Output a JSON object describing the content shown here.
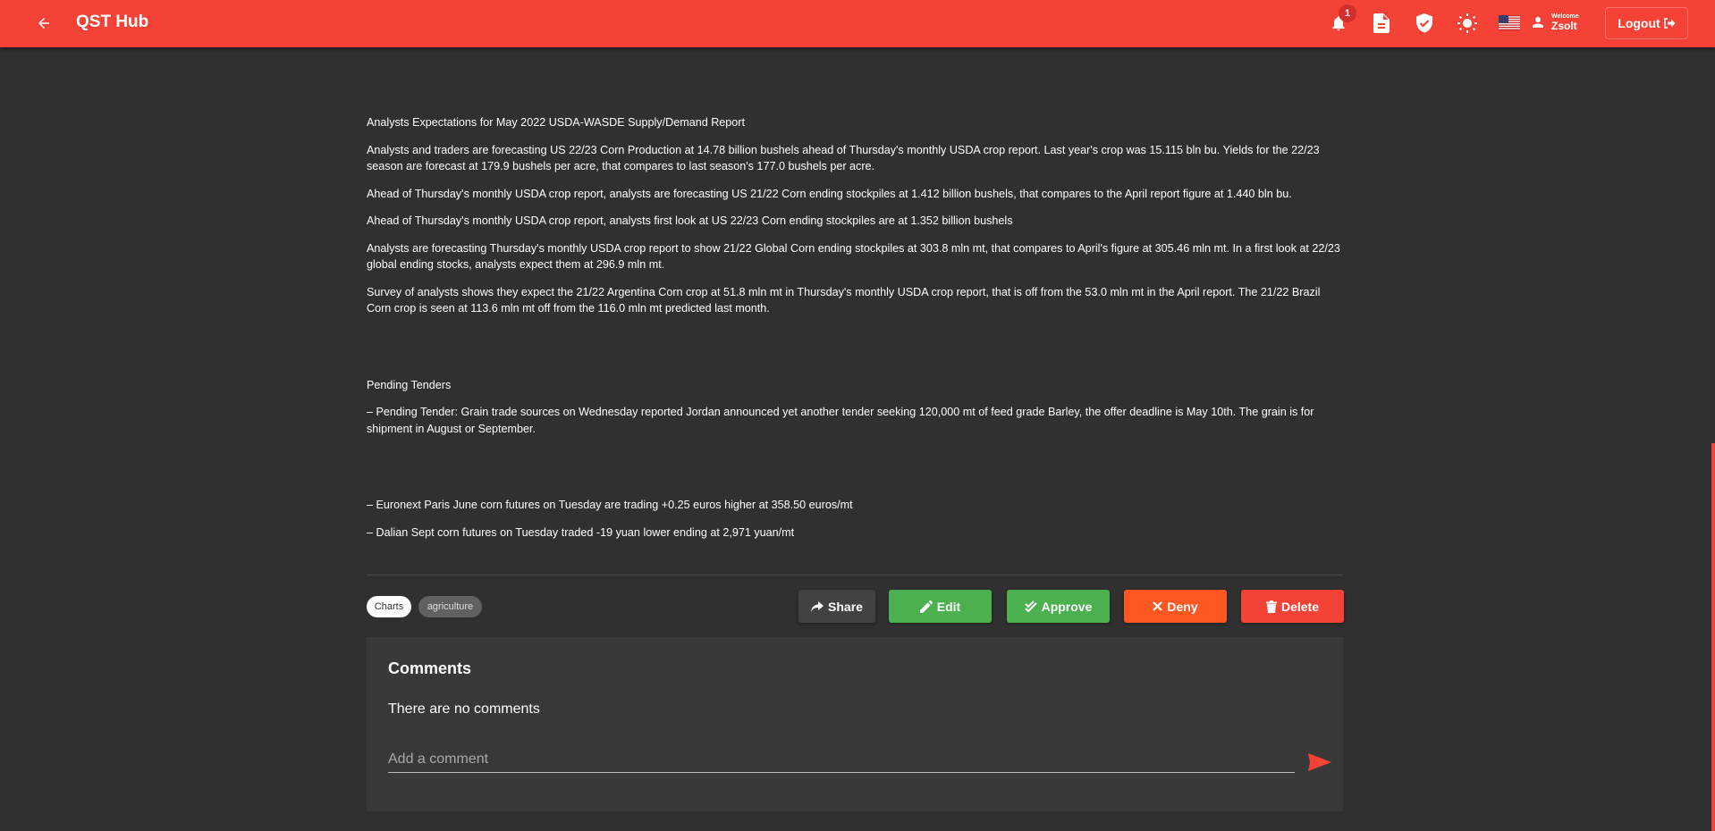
{
  "header": {
    "title": "QST Hub",
    "notification_count": "1",
    "welcome_label": "Welcome",
    "username": "Zsolt",
    "logout_label": "Logout",
    "icons": [
      "arrow-back-icon",
      "bell-icon",
      "document-icon",
      "shield-check-icon",
      "sun-icon",
      "us-flag-icon",
      "user-icon",
      "logout-icon"
    ]
  },
  "article": {
    "section1_title": "Analysts Expectations for May 2022 USDA-WASDE Supply/Demand Report",
    "paragraphs1": [
      "Analysts and traders are forecasting US 22/23 Corn Production at 14.78 billion bushels ahead of Thursday's monthly USDA crop report. Last year's crop was 15.115 bln bu. Yields for the 22/23 season are forecast at 179.9 bushels per acre, that compares to last season's 177.0 bushels per acre.",
      "Ahead of Thursday's monthly USDA crop report, analysts are forecasting US 21/22 Corn ending stockpiles at 1.412 billion bushels, that compares to the April report figure at 1.440 bln bu.",
      "Ahead of Thursday's monthly USDA crop report, analysts first look at US 22/23 Corn ending stockpiles are at 1.352 billion bushels",
      "Analysts are forecasting Thursday's monthly USDA crop report to show 21/22 Global Corn ending stockpiles at 303.8 mln mt, that compares to April's figure at 305.46 mln mt. In a first look at 22/23 global ending stocks, analysts expect them at 296.9 mln mt.",
      "Survey of analysts shows they expect the 21/22 Argentina Corn crop at 51.8 mln mt in Thursday's monthly USDA crop report, that is off from the 53.0 mln mt in the April report. The 21/22 Brazil Corn crop is seen at 113.6 mln mt off from the 116.0 mln mt predicted last month."
    ],
    "section2_title": "Pending Tenders",
    "tender": "– Pending Tender: Grain trade sources on Wednesday reported Jordan announced yet another tender seeking 120,000 mt of feed grade Barley, the offer deadline is May 10th. The grain is for shipment in August or September.",
    "futures": [
      "– Euronext Paris June corn futures on Tuesday are trading +0.25 euros higher at 358.50 euros/mt",
      "– Dalian Sept corn futures on Tuesday traded -19 yuan lower ending at 2,971 yuan/mt"
    ]
  },
  "tags": [
    "Charts",
    "agriculture"
  ],
  "actions": {
    "share": "Share",
    "edit": "Edit",
    "approve": "Approve",
    "deny": "Deny",
    "delete": "Delete"
  },
  "colors": {
    "brand": "#f44336",
    "approve": "#4caf50",
    "deny": "#ff5722",
    "background": "#303030"
  },
  "comments": {
    "title": "Comments",
    "empty_text": "There are no comments",
    "input_placeholder": "Add a comment",
    "input_value": ""
  }
}
